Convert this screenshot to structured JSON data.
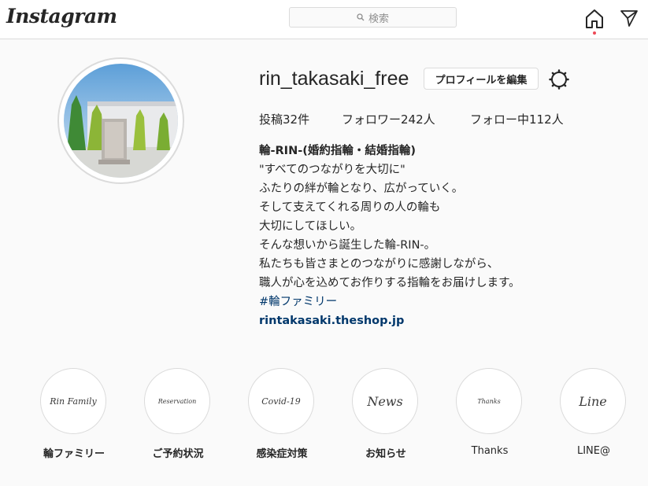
{
  "header": {
    "logo": "Instagram",
    "search_placeholder": "検索"
  },
  "profile": {
    "username": "rin_takasaki_free",
    "edit_button": "プロフィールを編集",
    "stats": {
      "posts": "投稿32件",
      "followers": "フォロワー242人",
      "following": "フォロー中112人"
    },
    "bio": {
      "name": "輪-RIN-(婚約指輪・結婚指輪)",
      "lines": [
        "\"すべてのつながりを大切に\"",
        "ふたりの絆が輪となり、広がっていく。",
        "そして支えてくれる周りの人の輪も",
        "大切にしてほしい。",
        "そんな想いから誕生した輪-RIN-。",
        "私たちも皆さまとのつながりに感謝しながら、",
        "職人が心を込めてお作りする指輪をお届けします。"
      ],
      "hashtag": "#輪ファミリー",
      "url": "rintakasaki.theshop.jp"
    }
  },
  "highlights": [
    {
      "cover": "Rin Family",
      "label": "輪ファミリー"
    },
    {
      "cover": "Reservation",
      "label": "ご予約状況"
    },
    {
      "cover": "Covid-19",
      "label": "感染症対策"
    },
    {
      "cover": "News",
      "label": "お知らせ"
    },
    {
      "cover": "Thanks",
      "label": "Thanks"
    },
    {
      "cover": "Line",
      "label": "LINE@"
    }
  ],
  "colors": {
    "link": "#00376b",
    "notification_dot": "#ed4956",
    "border": "#dbdbdb"
  },
  "icons": [
    "search-icon",
    "home-icon",
    "direct-message-icon",
    "settings-gear-icon"
  ]
}
